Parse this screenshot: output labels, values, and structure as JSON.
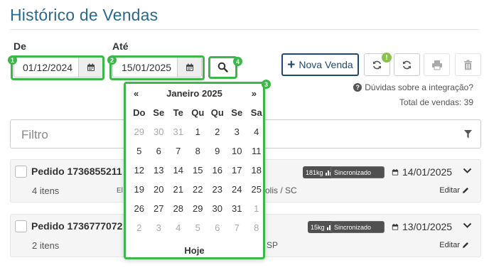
{
  "page": {
    "title": "Histórico de Vendas"
  },
  "filters": {
    "from_label": "De",
    "from_value": "01/12/2024",
    "to_label": "Até",
    "to_value": "15/01/2025"
  },
  "highlights": [
    "1",
    "2",
    "3",
    "4"
  ],
  "toolbar": {
    "new_sale_label": "Nova Venda",
    "warning_badge": "!",
    "help_text": "Dúvidas sobre a integração?",
    "help_icon": "?",
    "total_text": "Total de vendas: 39"
  },
  "filter_box": {
    "placeholder": "Filtro"
  },
  "calendar": {
    "prev": "«",
    "next": "»",
    "month_label": "Janeiro 2025",
    "weekdays": [
      "Do",
      "Se",
      "Te",
      "Qu",
      "Qu",
      "Se",
      "Sa"
    ],
    "weeks": [
      [
        "29",
        "30",
        "31",
        "1",
        "2",
        "3",
        "4"
      ],
      [
        "5",
        "6",
        "7",
        "8",
        "9",
        "10",
        "11"
      ],
      [
        "12",
        "13",
        "14",
        "15",
        "16",
        "17",
        "18"
      ],
      [
        "19",
        "20",
        "21",
        "22",
        "23",
        "24",
        "25"
      ],
      [
        "26",
        "27",
        "28",
        "29",
        "30",
        "31",
        "1"
      ],
      [
        "2",
        "3",
        "4",
        "5",
        "6",
        "7",
        "8"
      ]
    ],
    "today_label": "Hoje"
  },
  "orders": [
    {
      "title": "Pedido 1736855211",
      "items": "4 itens",
      "left_fragment": "El",
      "right_fragment": "olis / SC",
      "weight": "181kg",
      "status": "Sincronizado",
      "date": "14/01/2025",
      "edit_label": "Editar"
    },
    {
      "title": "Pedido 1736777072",
      "items": "2 itens",
      "left_fragment": "",
      "right_fragment": "SP",
      "weight": "15kg",
      "status": "Sincronizado",
      "date": "13/01/2025",
      "edit_label": "Editar"
    }
  ],
  "colors": {
    "title": "#2a6a8e",
    "highlight": "#3cb84a",
    "primary_button": "#1f4b6e",
    "warning_badge": "#8bc34a",
    "status_pill": "#505050"
  }
}
